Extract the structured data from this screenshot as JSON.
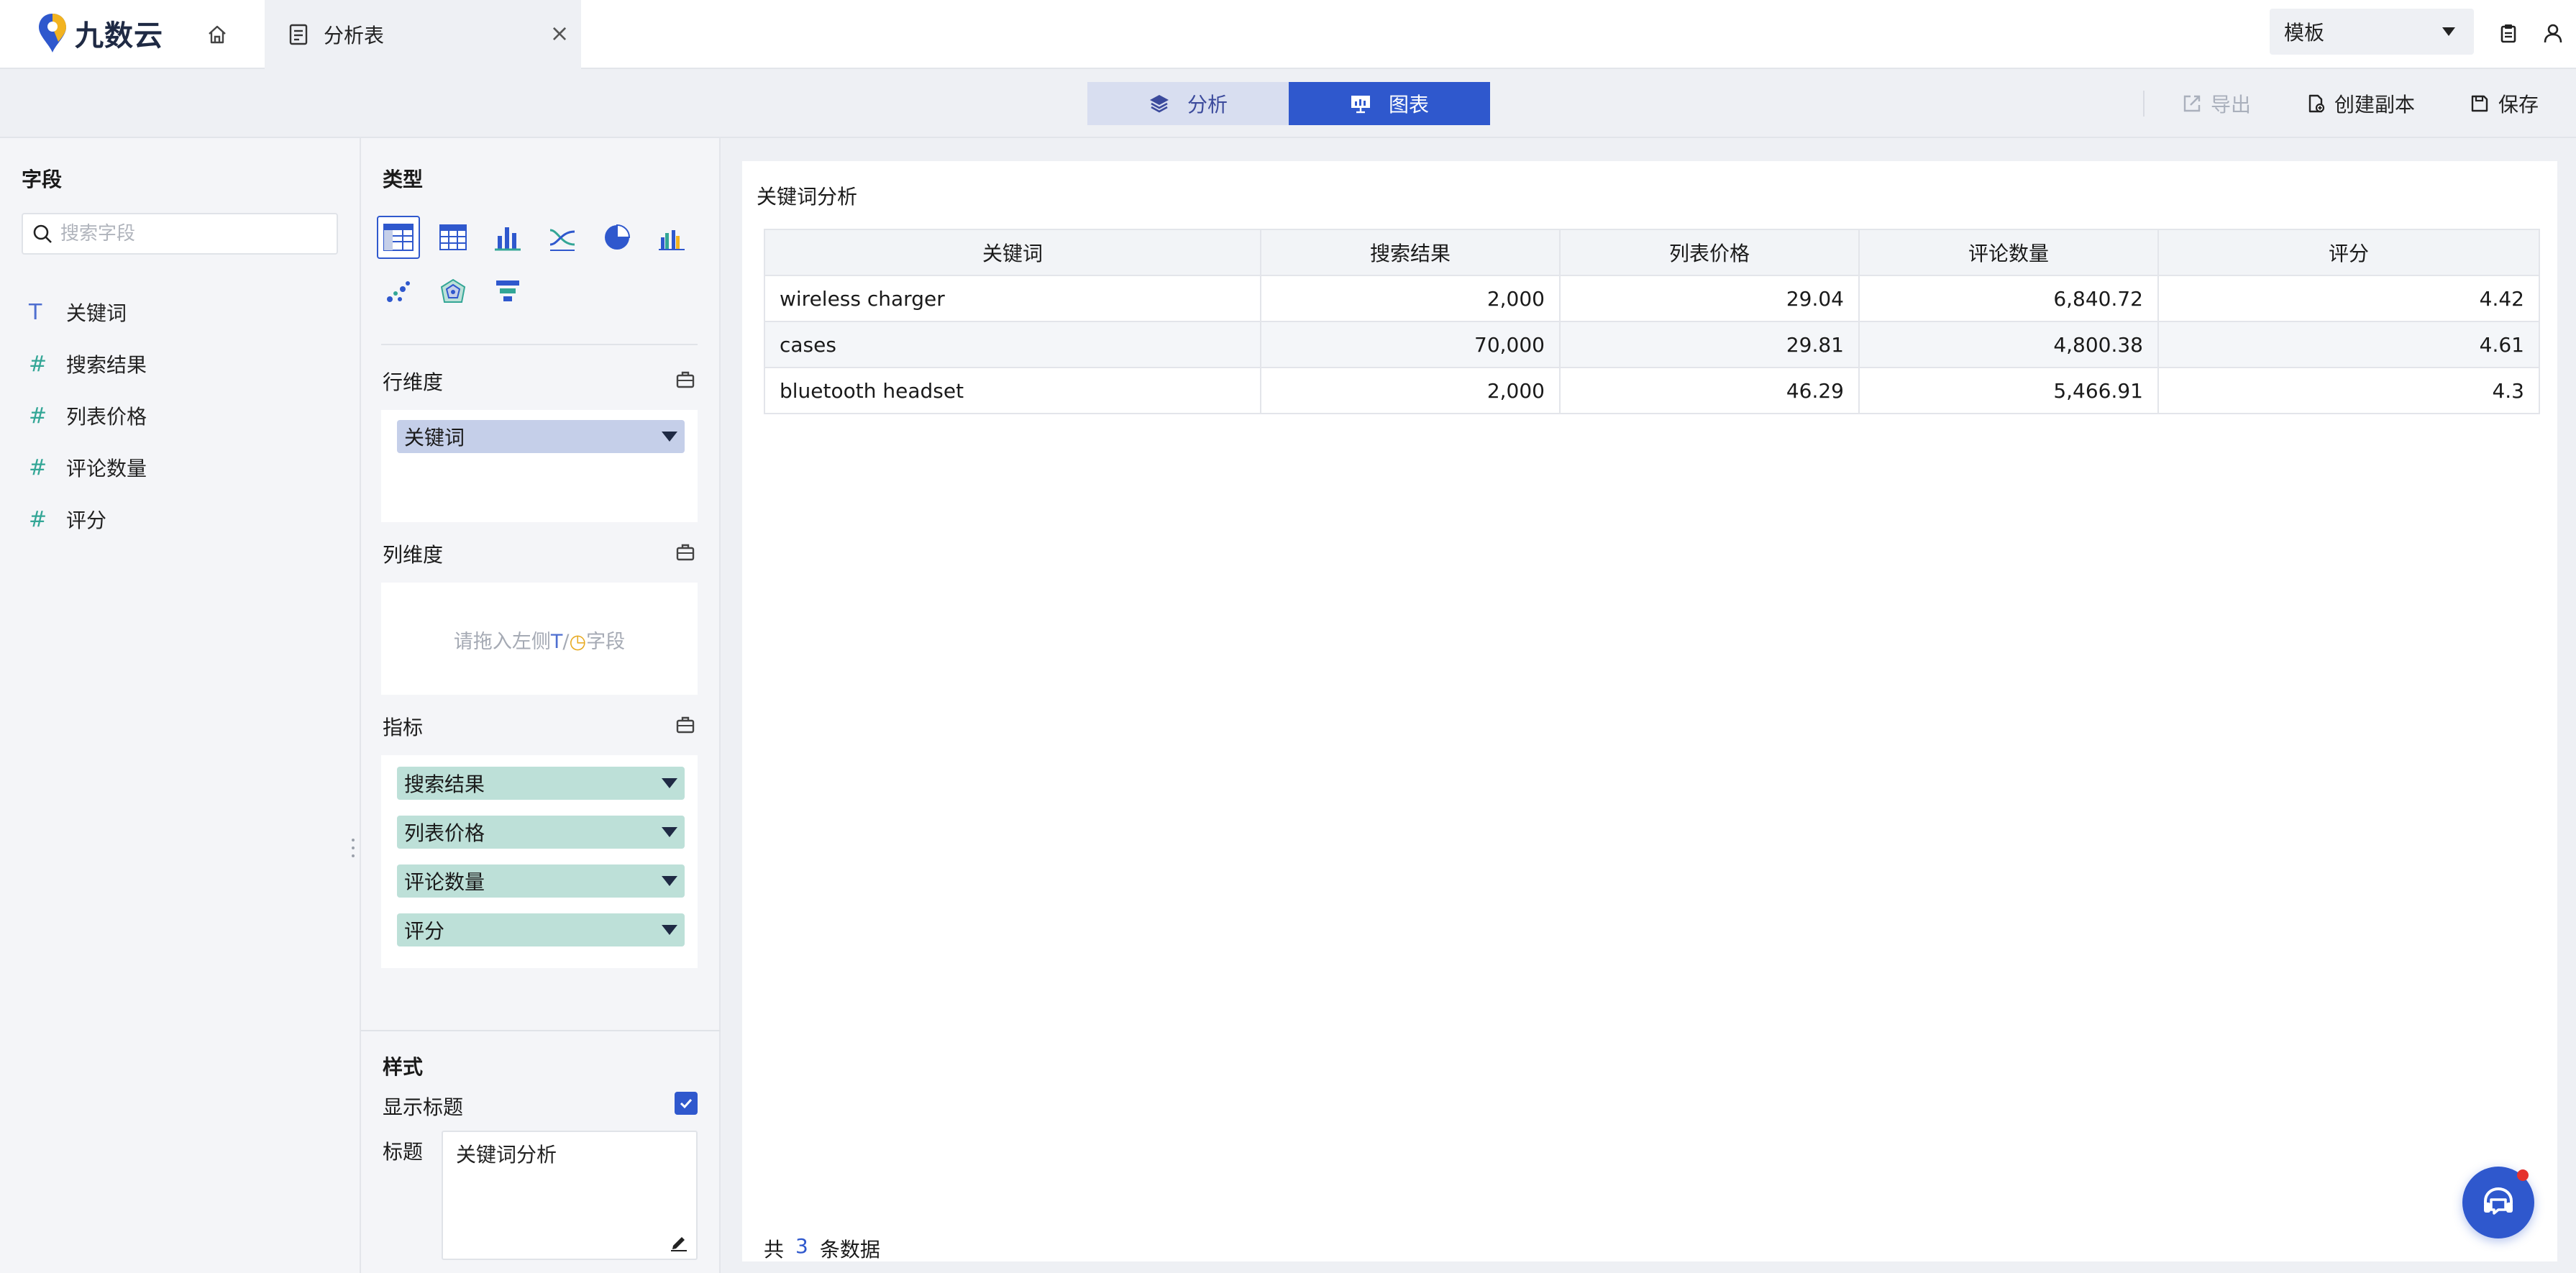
{
  "app": {
    "brand_name": "九数云",
    "tab_title": "分析表",
    "tab_close": "×",
    "template_select": "模板"
  },
  "toolbar": {
    "modes": [
      {
        "label": "分析",
        "active": false
      },
      {
        "label": "图表",
        "active": true
      }
    ],
    "export_label": "导出",
    "copy_label": "创建副本",
    "save_label": "保存"
  },
  "fields_panel": {
    "title": "字段",
    "search_placeholder": "搜索字段",
    "fields": [
      {
        "type_symbol": "T",
        "type": "text",
        "name": "关键词"
      },
      {
        "type_symbol": "#",
        "type": "number",
        "name": "搜索结果"
      },
      {
        "type_symbol": "#",
        "type": "number",
        "name": "列表价格"
      },
      {
        "type_symbol": "#",
        "type": "number",
        "name": "评论数量"
      },
      {
        "type_symbol": "#",
        "type": "number",
        "name": "评分"
      }
    ]
  },
  "config_panel": {
    "type_title": "类型",
    "chart_types": [
      "table",
      "detail-table",
      "bar",
      "line-cross",
      "pie",
      "combo-bar",
      "scatter",
      "radar",
      "funnel"
    ],
    "selected_type": "table",
    "row_dim": {
      "title": "行维度",
      "items": [
        "关键词"
      ]
    },
    "col_dim": {
      "title": "列维度",
      "hint_prefix": "请拖入左侧",
      "hint_t": "T",
      "hint_sep": "/",
      "hint_clock": "◷",
      "hint_suffix": "字段"
    },
    "measures": {
      "title": "指标",
      "items": [
        "搜索结果",
        "列表价格",
        "评论数量",
        "评分"
      ]
    },
    "style": {
      "title": "样式",
      "show_title_label": "显示标题",
      "show_title_checked": true,
      "title_label": "标题",
      "title_value": "关键词分析"
    }
  },
  "main": {
    "card_title": "关键词分析",
    "table": {
      "columns": [
        "关键词",
        "搜索结果",
        "列表价格",
        "评论数量",
        "评分"
      ],
      "rows": [
        [
          "wireless charger",
          "2,000",
          "29.04",
          "6,840.72",
          "4.42"
        ],
        [
          "cases",
          "70,000",
          "29.81",
          "4,800.38",
          "4.61"
        ],
        [
          "bluetooth headset",
          "2,000",
          "46.29",
          "5,466.91",
          "4.3"
        ]
      ]
    },
    "footer": {
      "prefix": "共",
      "count": "3",
      "suffix": "条数据"
    }
  },
  "colors": {
    "accent": "#2f58cd",
    "dimension_pill": "#c5cfe9",
    "measure_pill": "#bde0d8",
    "number_type": "#33a696",
    "text_type": "#4f6fd0"
  }
}
